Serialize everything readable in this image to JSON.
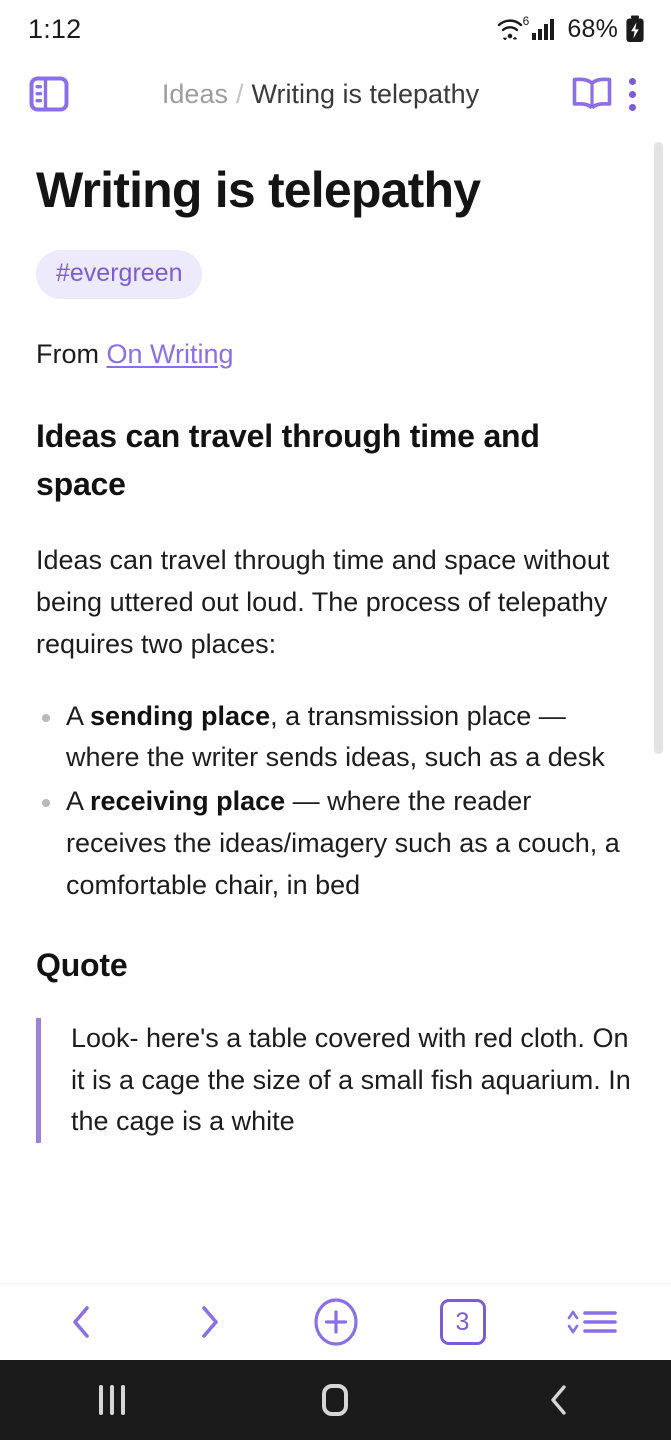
{
  "status_bar": {
    "time": "1:12",
    "wifi_icon": "wifi-icon",
    "wifi_generation": "6",
    "signal_icon": "cellular-signal-icon",
    "battery_percent": "68%",
    "battery_icon": "battery-charging-icon"
  },
  "header": {
    "sidebar_toggle_icon": "sidebar-panel-icon",
    "breadcrumb_parent": "Ideas",
    "breadcrumb_separator": "/",
    "breadcrumb_current": "Writing is telepathy",
    "reading_mode_icon": "open-book-icon",
    "overflow_icon": "kebab-menu-icon"
  },
  "note": {
    "title": "Writing is telepathy",
    "tag": "#evergreen",
    "source_prefix": "From",
    "source_link": "On Writing",
    "heading_1": "Ideas can travel through time and space",
    "paragraph_1": "Ideas can travel through time and space without being uttered out loud. The process of telepathy requires two places:",
    "bullets": [
      {
        "lead": "A ",
        "bold": "sending place",
        "rest": ", a transmission place — where the writer sends ideas, such as a desk"
      },
      {
        "lead": "A ",
        "bold": "receiving place",
        "rest": " — where the reader receives the ideas/imagery such as a couch, a comfortable chair, in bed"
      }
    ],
    "heading_2": "Quote",
    "blockquote": "Look- here's a table covered with red cloth. On it is a cage the size of a small fish aquarium. In the cage is a white"
  },
  "toolbar": {
    "back_icon": "chevron-left-icon",
    "forward_icon": "chevron-right-icon",
    "add_icon": "plus-circle-icon",
    "tab_count": "3",
    "sort_icon": "sort-lines-icon"
  },
  "nav_bar": {
    "recents_icon": "recents-icon",
    "home_icon": "home-icon",
    "back_icon": "android-back-icon"
  },
  "colors": {
    "accent_purple": "#7c5cd6",
    "link_purple": "#8b6fe8",
    "tag_background": "#edeafb",
    "quote_border": "#9b82e0",
    "text_primary": "#1d1d1d",
    "text_muted": "#9d9d9d",
    "nav_background": "#1b1b1b"
  }
}
